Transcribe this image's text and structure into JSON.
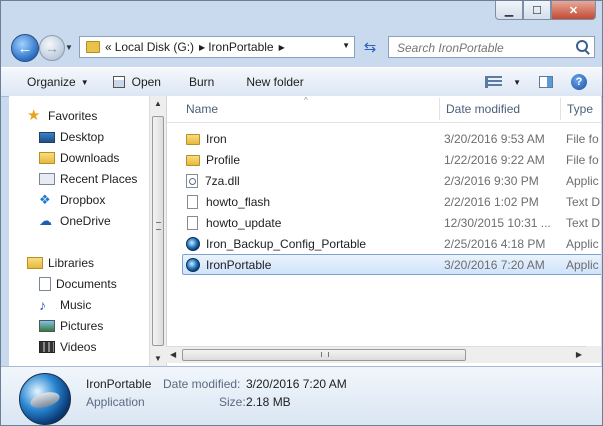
{
  "window": {
    "controls": {
      "minimize": "▁",
      "maximize": "☐",
      "close": "✕"
    }
  },
  "address": {
    "prefix": "«",
    "crumbs": [
      "Local Disk (G:)",
      "IronPortable"
    ],
    "search_placeholder": "Search IronPortable"
  },
  "toolbar": {
    "organize": "Organize",
    "open": "Open",
    "burn": "Burn",
    "new_folder": "New folder"
  },
  "nav": {
    "favorites": "Favorites",
    "items": [
      "Desktop",
      "Downloads",
      "Recent Places",
      "Dropbox",
      "OneDrive"
    ],
    "libraries": "Libraries",
    "lib_items": [
      "Documents",
      "Music",
      "Pictures",
      "Videos"
    ]
  },
  "columns": {
    "name": "Name",
    "date": "Date modified",
    "type": "Type"
  },
  "files": [
    {
      "name": "Iron",
      "date": "3/20/2016 9:53 AM",
      "type": "File fo",
      "icon": "folder"
    },
    {
      "name": "Profile",
      "date": "1/22/2016 9:22 AM",
      "type": "File fo",
      "icon": "folder"
    },
    {
      "name": "7za.dll",
      "date": "2/3/2016 9:30 PM",
      "type": "Applic",
      "icon": "dll"
    },
    {
      "name": "howto_flash",
      "date": "2/2/2016 1:02 PM",
      "type": "Text D",
      "icon": "doc"
    },
    {
      "name": "howto_update",
      "date": "12/30/2015 10:31 ...",
      "type": "Text D",
      "icon": "doc"
    },
    {
      "name": "Iron_Backup_Config_Portable",
      "date": "2/25/2016 4:18 PM",
      "type": "Applic",
      "icon": "iron"
    },
    {
      "name": "IronPortable",
      "date": "3/20/2016 7:20 AM",
      "type": "Applic",
      "icon": "iron"
    }
  ],
  "details": {
    "name": "IronPortable",
    "kind": "Application",
    "date_label": "Date modified:",
    "date_value": "3/20/2016 7:20 AM",
    "size_label": "Size:",
    "size_value": "2.18 MB"
  }
}
